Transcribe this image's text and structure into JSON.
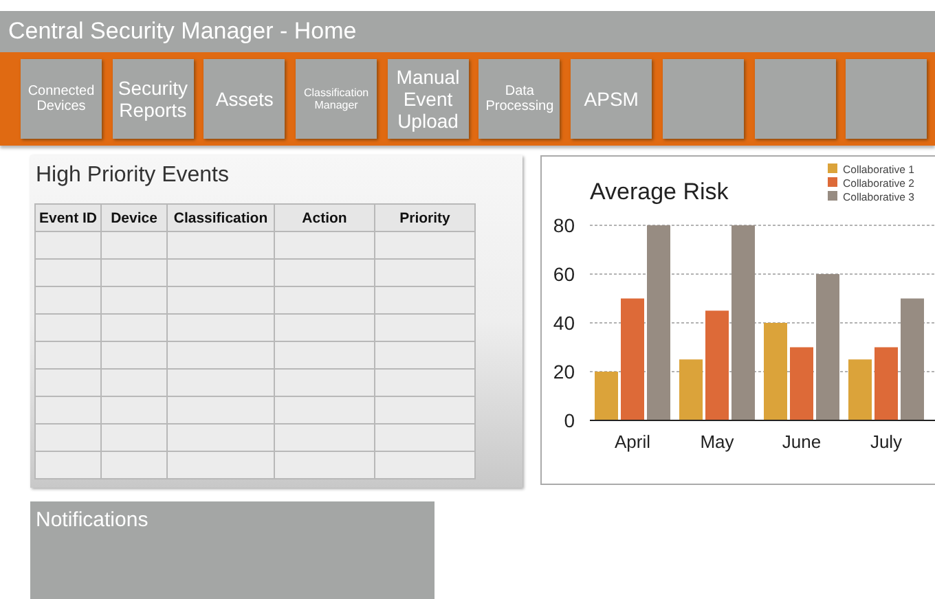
{
  "window": {
    "title": "Central Security Manager  - Home"
  },
  "nav": {
    "tiles": [
      {
        "kind": "small",
        "label": "Connected Devices"
      },
      {
        "kind": "large",
        "label": "Security Reports"
      },
      {
        "kind": "large",
        "label": "Assets"
      },
      {
        "kind": "tiny",
        "label": "Classification Manager"
      },
      {
        "kind": "large",
        "label": "Manual Event Upload"
      },
      {
        "kind": "small",
        "label": "Data Processing"
      },
      {
        "kind": "large",
        "label": "APSM"
      },
      {
        "kind": "blank"
      },
      {
        "kind": "blank"
      },
      {
        "kind": "blank"
      }
    ]
  },
  "events_panel": {
    "title": "High Priority Events",
    "table": {
      "columns": [
        "Event ID",
        "Device",
        "Classification",
        "Action",
        "Priority"
      ],
      "rows": [
        {
          "kind": "blank"
        },
        {
          "kind": "blank"
        },
        {
          "kind": "blank"
        },
        {
          "kind": "blank"
        },
        {
          "kind": "blank"
        },
        {
          "kind": "blank"
        },
        {
          "kind": "blank"
        },
        {
          "kind": "blank"
        },
        {
          "kind": "blank"
        }
      ]
    }
  },
  "risk_panel": {
    "chart_data": {
      "type": "bar",
      "title": "Average Risk",
      "categories": [
        "April",
        "May",
        "June",
        "July"
      ],
      "series": [
        {
          "name": "Collaborative 1",
          "color": "#dba33a",
          "values": [
            20,
            25,
            40,
            25
          ]
        },
        {
          "name": "Collaborative 2",
          "color": "#dd6a38",
          "values": [
            50,
            45,
            30,
            30
          ]
        },
        {
          "name": "Collaborative 3",
          "color": "#978c82",
          "values": [
            80,
            80,
            60,
            50
          ]
        }
      ],
      "ylim": [
        0,
        80
      ],
      "yticks": [
        0,
        20,
        40,
        60,
        80
      ],
      "grid": true,
      "legend": true
    }
  },
  "notifications": {
    "title": "Notifications"
  }
}
